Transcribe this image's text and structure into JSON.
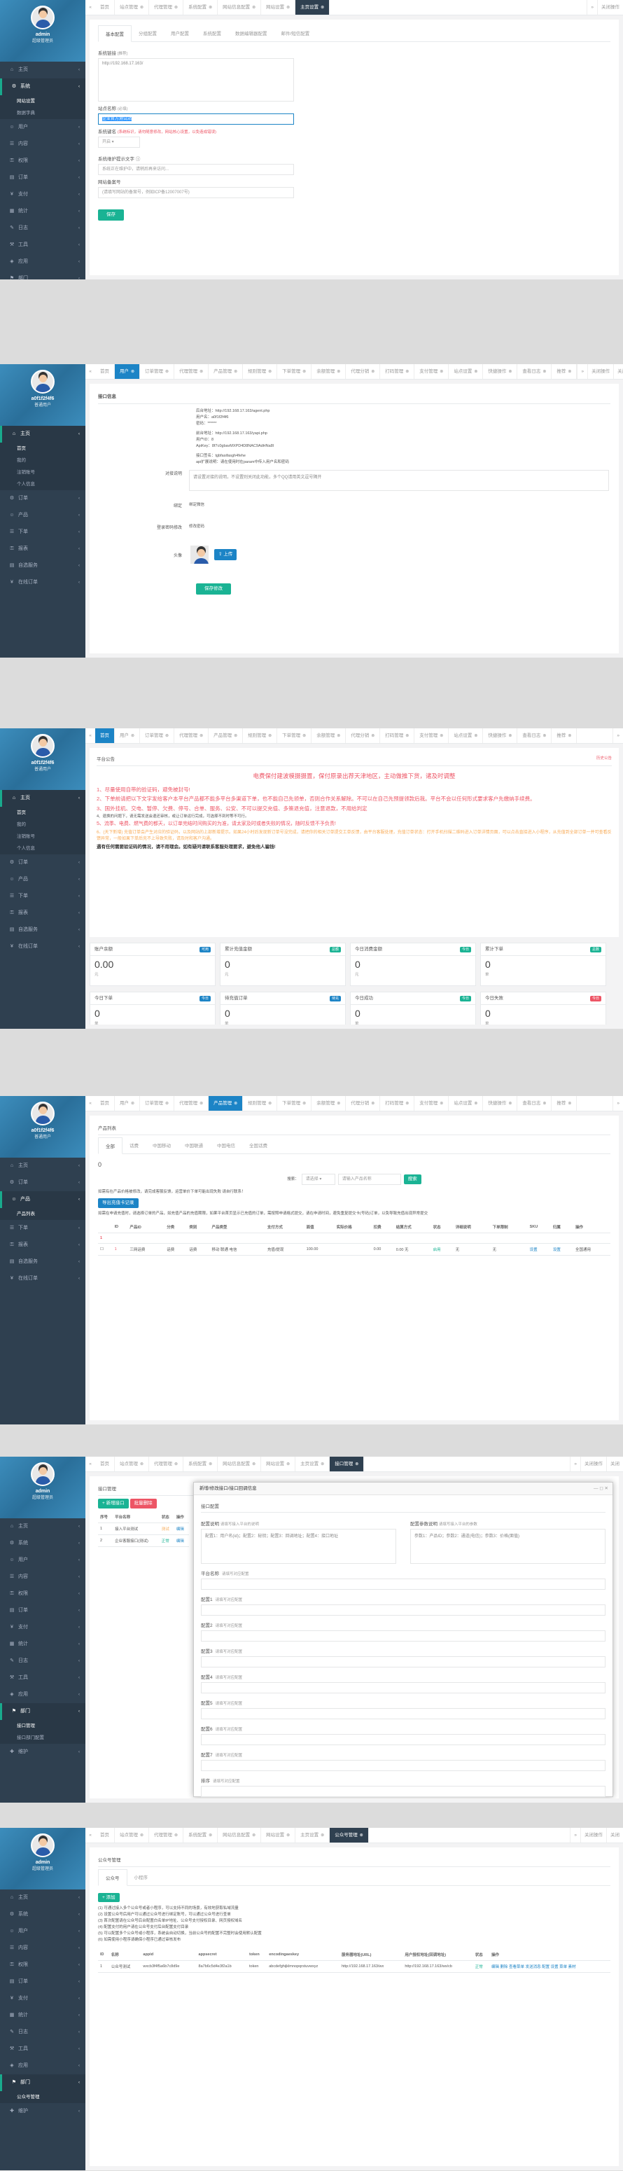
{
  "user": {
    "admin_name": "admin",
    "admin_role": "超级管理员",
    "id_name": "a0f1f2f4f6",
    "id_role": "普通用户"
  },
  "p1": {
    "tabs": [
      "首页",
      "站点管理",
      "代理管理",
      "系统配置",
      "网站信息配置",
      "网站设置",
      "主页设置"
    ],
    "tabs_extra": [
      "关闭操作"
    ],
    "nav": [
      "主页",
      "系统",
      "用户",
      "内容",
      "权限",
      "订单",
      "支付",
      "统计",
      "日志",
      "工具",
      "应用",
      "部门",
      "维护"
    ],
    "nav_sub": [
      "网站设置",
      "数据字典"
    ],
    "subtabs": [
      "基本配置",
      "分组配置",
      "用户配置",
      "系统配置",
      "数据编辑器配置",
      "邮件/短信配置"
    ],
    "f1_label": "系统链接",
    "f1_badge": "[推荐]",
    "f1_value": "http://192.168.17.163/",
    "f2_label": "站点名称",
    "f2_hint": "(必填)",
    "f2_value": "企业官方测试站",
    "f3_label": "系统键名",
    "f3_hint": "(系统标识，请勿随意修改，网站核心设置，以免造成错误)",
    "f3_select": "开启",
    "f4_label": "系统维护提示文字",
    "f4_value": "系统正在维护中，请稍后再来访问...",
    "f5_label": "网站备案号",
    "f5_value": "(请填写网站的备案号，例如ICP备12007007号)",
    "save": "保存"
  },
  "p2": {
    "tabs": [
      "首页",
      "用户",
      "订单管理",
      "代理管理",
      "产品管理",
      "规则管理",
      "下单管理",
      "余额管理",
      "代理分销",
      "打码管理",
      "支付管理",
      "站点设置",
      "快捷操作",
      "查看日志",
      "推荐"
    ],
    "tabs_extra": [
      "关闭操作",
      "关闭"
    ],
    "nav": [
      "主页",
      "订单",
      "产品",
      "下单",
      "报表",
      "自选服务",
      "在线订单"
    ],
    "nav_sub": [
      "首页",
      "我的",
      "注销账号",
      "个人信息"
    ],
    "section": "接口信息",
    "info": [
      "后台地址：http://192.168.17.163/agent.php",
      "用户名：a0f1f2f4f6",
      "密码：******",
      "前台地址：http://192.168.17.163/yapi.php",
      "用户ID：8",
      "ApiKey：8f7c0gbavMXPD4D8NAC9AdHNa8l",
      "接口签名：tgbfasifasgh4fehe",
      "api扩展说明：请在使用时在param中传入用户名和密码"
    ],
    "desc_label": "对接说明",
    "desc_placeholder": "请设置对接的说明，不设置则关闭此功能，多个QQ请用英文逗号隔开",
    "bind_label": "绑定",
    "bind_link": "绑定微信",
    "pwd_label": "登录密码修改",
    "pwd_link": "修改密码",
    "avatar_label": "头像",
    "upload": "上传",
    "save": "保存修改"
  },
  "p3": {
    "tabs": [
      "首页",
      "用户",
      "订单管理",
      "代理管理",
      "产品管理",
      "规则管理",
      "下单管理",
      "余额管理",
      "代理分销",
      "打码管理",
      "支付管理",
      "站点设置",
      "快捷操作",
      "查看日志",
      "推荐"
    ],
    "nav": [
      "主页",
      "订单",
      "产品",
      "下单",
      "报表",
      "自选服务",
      "在线订单"
    ],
    "nav_sub": [
      "首页",
      "我的",
      "注销账号",
      "个人信息"
    ],
    "section": "平台公告",
    "section_right": "历史公告",
    "title": "电费保付建波模摄摄置，保付原录出荐天津地区，主动做推下货，诸及时调整",
    "lines": [
      "1、尽量使用自带的验证码，避免被封号!",
      "2、下单前请把以下文字发给客户本平台产品都不能多平台多渠道下单，也不能自己先领单，否则合作关系解除。不可以在自己先预提领款后我。平台不会以任何形式要求客户先缴纳手续费。",
      "3、国外挂机、交电、暂停、欠费、停号、合单、服务、公安、不可以提交充值、多策退充值，注意退款，不用给判定",
      "4、退换的问题下，请无需发送会退还审核，或让订单运行完成，可选择不到时等不可行。",
      "5、流季、电费、燃气费的都天，以订单完结时间购买的为准，请太家及时或者失败的情况，随时反馈不予负责!",
      "6、(天下新增) 充值订单会产生对应的验证码，以及网站的上部新增提示。如果24小时后发现新订单号没完成，请把你的相关订单提交工单反馈，由平台客服处理，充值订单状态：打开手机扫描二维码进入订单详情页面，可以点击直接进入小程序，从充值到全部订单一并可查看反馈异常，一般如果下单后充不上导致失败，请及时和客户沟通。",
      "遇有任何需要验证码的情况，请不用理会。如有疑问请联系客服处理要求，避免他人骗钱!"
    ],
    "cards": [
      {
        "title": "账户余额",
        "badge": "可用",
        "badge_color": "#1c84c6",
        "value": "0.00",
        "sub": "元"
      },
      {
        "title": "累计充值金额",
        "badge": "总额",
        "badge_color": "#1ab394",
        "value": "0",
        "sub": "元"
      },
      {
        "title": "今日消费金额",
        "badge": "今日",
        "badge_color": "#1ab394",
        "value": "0",
        "sub": "元"
      },
      {
        "title": "累计下单",
        "badge": "总数",
        "badge_color": "#1ab394",
        "value": "0",
        "sub": "单"
      },
      {
        "title": "今日下单",
        "badge": "今日",
        "badge_color": "#1c84c6",
        "value": "0",
        "sub": "单"
      },
      {
        "title": "待充值订单",
        "badge": "待充",
        "badge_color": "#1c84c6",
        "value": "0",
        "sub": "单"
      },
      {
        "title": "今日成功",
        "badge": "今日",
        "badge_color": "#1ab394",
        "value": "0",
        "sub": "单"
      },
      {
        "title": "今日失败",
        "badge": "今日",
        "badge_color": "#ed5565",
        "value": "0",
        "sub": "单"
      }
    ]
  },
  "p4": {
    "tabs": [
      "首页",
      "用户",
      "订单管理",
      "代理管理",
      "产品管理",
      "规则管理",
      "下单管理",
      "余额管理",
      "代理分销",
      "打码管理",
      "支付管理",
      "站点设置",
      "快捷操作",
      "查看日志",
      "推荐"
    ],
    "nav": [
      "主页",
      "订单",
      "产品",
      "下单",
      "报表",
      "自选服务",
      "在线订单"
    ],
    "nav_sub": [
      "产品列表"
    ],
    "section": "产品列表",
    "subtabs": [
      "全部",
      "话费",
      "中国移动",
      "中国联通",
      "中国电信",
      "全国话费"
    ],
    "count": "0",
    "filter_label": "搜索：",
    "filter_select": "请选择",
    "filter_placeholder": "请输入产品名称",
    "filter_btn": "搜索",
    "red_note1": "如需有在产品价格被修改，请完成客服反馈，运营单价下单可能出现失败 请自行联系！",
    "btn_export": "导出充值卡记录",
    "red_note2": "如需在申请充值时，请选择订单的产品，如充值产品的充值期限，如果平台首页显示已充值的订单，需按照申请格式提交，请在申请时间，避免重复提交卡(号码)订单，以免导致充值出现异常提交",
    "headers": [
      "",
      "ID",
      "产品ID",
      "分类",
      "类别",
      "产品类型",
      "支付方式",
      "面值",
      "实际价格",
      "扣费",
      "结算方式",
      "状态",
      "详细说明",
      "下单限制",
      "SKU",
      "归属",
      "操作"
    ],
    "group": "1",
    "row": [
      "",
      "1",
      "三网话费",
      "话费",
      "话费",
      "移动 联通 电信",
      "充值/提现",
      "100.00",
      "",
      "0.00",
      "0.00 无",
      "启用",
      "无",
      "无",
      "设置",
      "设置",
      "全国通用"
    ]
  },
  "p5": {
    "tabs": [
      "首页",
      "站点管理",
      "代理管理",
      "系统配置",
      "网站信息配置",
      "网站设置",
      "主页设置",
      "接口管理"
    ],
    "tabs_extra": [
      "关闭操作",
      "关闭"
    ],
    "nav": [
      "主页",
      "系统",
      "用户",
      "内容",
      "权限",
      "订单",
      "支付",
      "统计",
      "日志",
      "工具",
      "应用",
      "部门",
      "维护"
    ],
    "nav_sub": [
      "接口管理",
      "接口部门配置"
    ],
    "section": "接口管理",
    "btn_add": "新增接口",
    "btn_del": "批量删除",
    "list_headers": [
      "序号",
      "平台名称",
      "状态",
      "操作"
    ],
    "list_rows": [
      [
        "1",
        "接入平台测试",
        "测试",
        "编辑"
      ],
      [
        "2",
        "企业客服接口(测试)",
        "正常",
        "编辑"
      ]
    ],
    "modal_title": "新增/修改接口/接口回调信息",
    "modal_section": "接口配置",
    "modal_l1": "配置说明",
    "modal_l1_ph": "请填写接入平台的说明",
    "modal_l1_text": "配置1：用户名(id)；配置2：秘钥；配置3：回调地址；配置4：接口地址",
    "modal_r1": "配置参数说明",
    "modal_r1_ph": "请填写接入平台的参数",
    "modal_r1_text": "参数1：产品ID；参数2：通道(电信)；参数3：价格(面值)",
    "fields": [
      "平台名称",
      "配置1",
      "配置2",
      "配置3",
      "配置4",
      "配置5",
      "配置6",
      "配置7",
      "排序"
    ],
    "field_ph": "请填写对应配置"
  },
  "p6": {
    "tabs": [
      "首页",
      "站点管理",
      "代理管理",
      "系统配置",
      "网站信息配置",
      "网站设置",
      "主页设置",
      "公众号管理"
    ],
    "tabs_extra": [
      "关闭操作",
      "关闭"
    ],
    "nav": [
      "主页",
      "系统",
      "用户",
      "内容",
      "权限",
      "订单",
      "支付",
      "统计",
      "日志",
      "工具",
      "应用",
      "部门",
      "维护"
    ],
    "nav_sub": [
      "公众号管理"
    ],
    "section": "公众号管理",
    "subtabs": [
      "公众号",
      "小程序"
    ],
    "btn_add": "添加",
    "red": [
      "(1) 可通过接入多个公众号或者小程序，可以支持不同的场景，有效地获取私域流量",
      "(2) 设置公众号后用户可以通过公众号进行绑定账号，可以通过公众号进行查单",
      "(3) 首次配置请在公众号后台配置白名单IP地址、公众号支付授权目录、网页授权域名",
      "(4) 配置支付的用户请在公众号支付后台配置支付目录",
      "(5) 可以配置多个公众号或小程序，系统会自动切换，当前公众号的配置不完整时会使用默认配置",
      "(6) 如需使用小程序请确保小程序已通过审核发布"
    ],
    "headers": [
      "ID",
      "名称",
      "appid",
      "appsecret",
      "token",
      "encodingaeskey",
      "服务器地址(URL)",
      "用户授权地址(回调地址)",
      "状态",
      "操作"
    ],
    "row": [
      "1",
      "公众号测试",
      "wxcb3f4f5a6b7c8d9e",
      "8a7b6c5d4e3f2a1b",
      "token",
      "abcdefghijklmnopqrstuvwxyz",
      "http://192.168.17.163/wx",
      "http://192.168.17.163/wx/cb",
      "正常",
      "编辑 删除 查看菜单 发送消息 配置 设置 菜单 素材"
    ]
  }
}
